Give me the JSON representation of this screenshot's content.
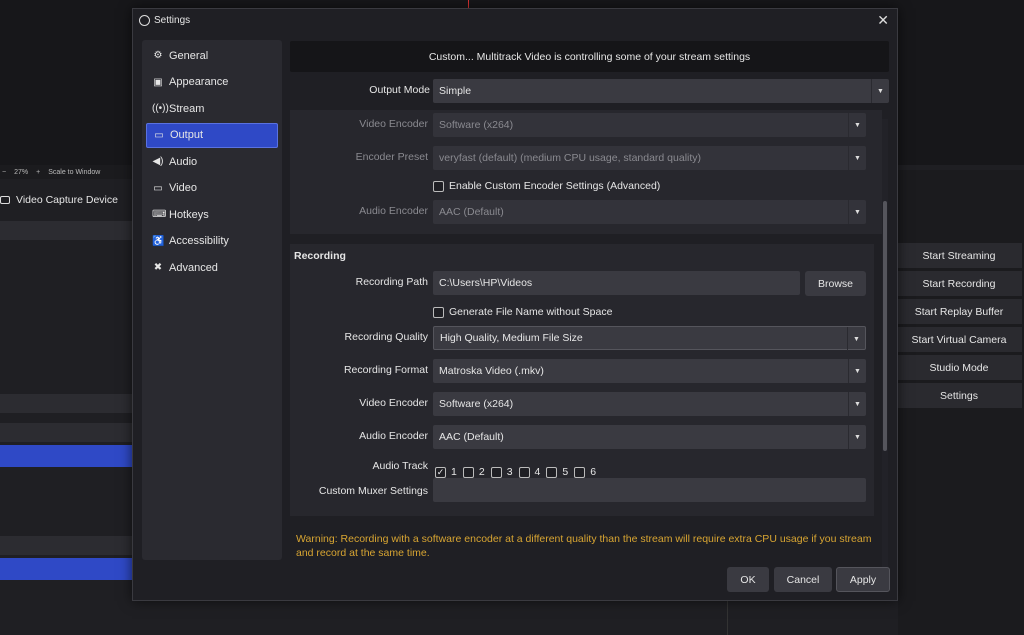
{
  "background": {
    "zoom_label": "27%",
    "scale_label": "Scale to Window",
    "source_name": "Video Capture Device",
    "controls": [
      "Start Streaming",
      "Start Recording",
      "Start Replay Buffer",
      "Start Virtual Camera",
      "Studio Mode",
      "Settings"
    ]
  },
  "dialog": {
    "title": "Settings",
    "banner": "Custom... Multitrack Video is controlling some of your stream settings"
  },
  "sidebar": {
    "items": [
      {
        "label": "General",
        "icon": "gear-icon"
      },
      {
        "label": "Appearance",
        "icon": "appearance-icon"
      },
      {
        "label": "Stream",
        "icon": "stream-icon"
      },
      {
        "label": "Output",
        "icon": "output-icon",
        "active": true
      },
      {
        "label": "Audio",
        "icon": "speaker-icon"
      },
      {
        "label": "Video",
        "icon": "monitor-icon"
      },
      {
        "label": "Hotkeys",
        "icon": "keyboard-icon"
      },
      {
        "label": "Accessibility",
        "icon": "accessibility-icon"
      },
      {
        "label": "Advanced",
        "icon": "wrench-icon"
      }
    ]
  },
  "output": {
    "mode_label": "Output Mode",
    "mode_value": "Simple",
    "streaming": {
      "video_encoder_label": "Video Encoder",
      "video_encoder_value": "Software (x264)",
      "encoder_preset_label": "Encoder Preset",
      "encoder_preset_value": "veryfast (default) (medium CPU usage, standard quality)",
      "custom_encoder_label": "Enable Custom Encoder Settings (Advanced)",
      "audio_encoder_label": "Audio Encoder",
      "audio_encoder_value": "AAC (Default)"
    },
    "recording": {
      "title": "Recording",
      "path_label": "Recording Path",
      "path_value": "C:\\Users\\HP\\Videos",
      "browse_label": "Browse",
      "filename_nospace_label": "Generate File Name without Space",
      "quality_label": "Recording Quality",
      "quality_value": "High Quality, Medium File Size",
      "format_label": "Recording Format",
      "format_value": "Matroska Video (.mkv)",
      "video_encoder_label": "Video Encoder",
      "video_encoder_value": "Software (x264)",
      "audio_encoder_label": "Audio Encoder",
      "audio_encoder_value": "AAC (Default)",
      "audio_track_label": "Audio Track",
      "tracks": [
        "1",
        "2",
        "3",
        "4",
        "5",
        "6"
      ],
      "tracks_checked": [
        true,
        false,
        false,
        false,
        false,
        false
      ],
      "muxer_label": "Custom Muxer Settings",
      "muxer_value": ""
    },
    "warning": "Warning: Recording with a software encoder at a different quality than the stream will require extra CPU usage if you stream and record at the same time."
  },
  "buttons": {
    "ok": "OK",
    "cancel": "Cancel",
    "apply": "Apply"
  }
}
